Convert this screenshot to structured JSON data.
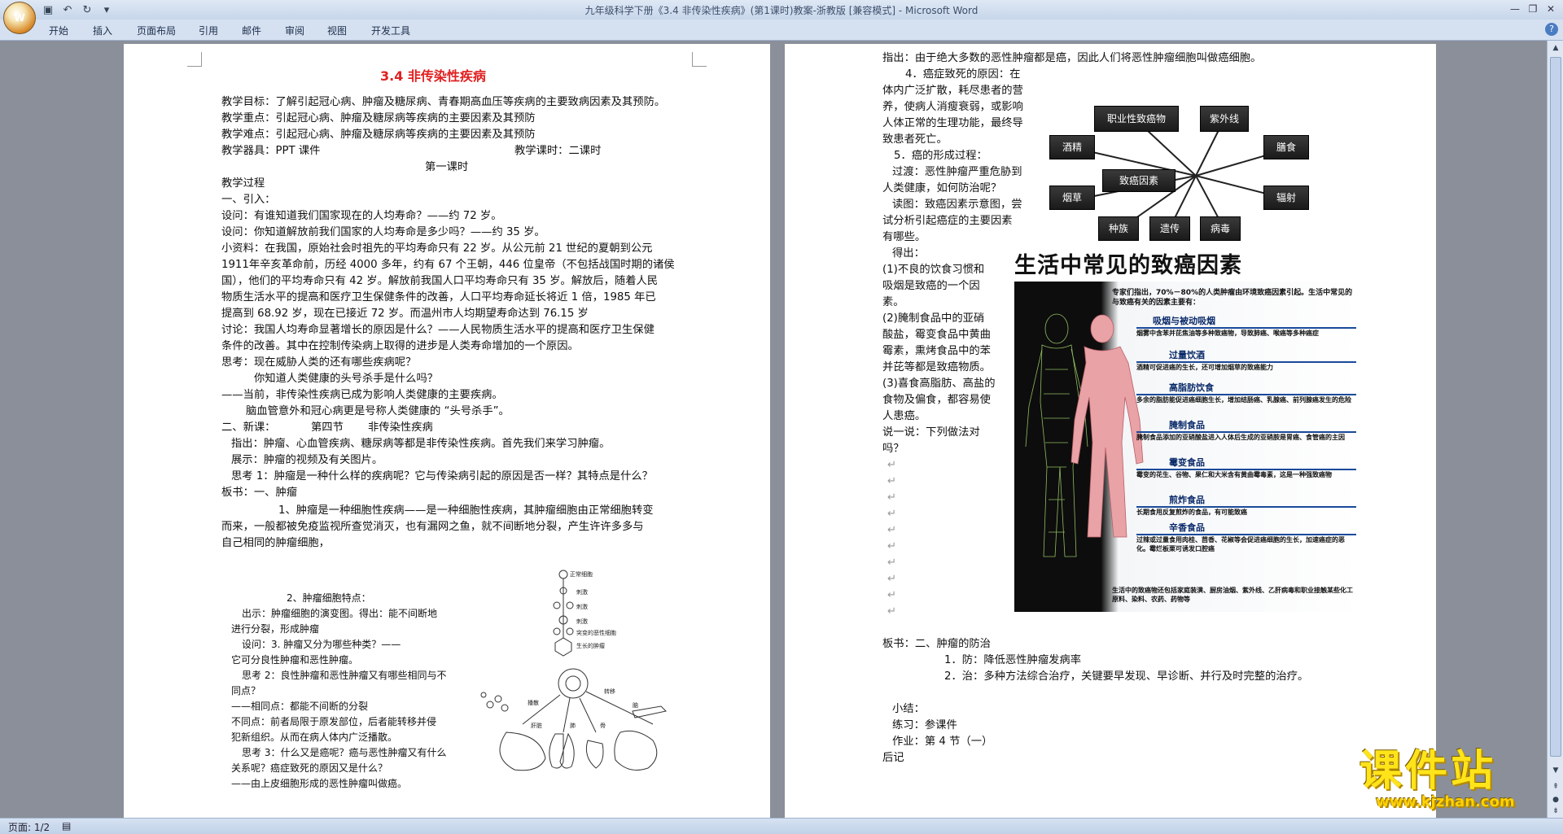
{
  "window": {
    "title": "九年级科学下册《3.4 非传染性疾病》(第1课时)教案-浙教版 [兼容模式] - Microsoft Word",
    "office_button": "W"
  },
  "ribbon": {
    "tabs": [
      "开始",
      "插入",
      "页面布局",
      "引用",
      "邮件",
      "审阅",
      "视图",
      "开发工具"
    ]
  },
  "status": {
    "page": "页面: 1/2"
  },
  "watermark": {
    "text": "课件站",
    "url": "www.kjzhan.com"
  },
  "left_page": {
    "title": "3.4 非传染性疾病",
    "lines": [
      "教学目标：了解引起冠心病、肿瘤及糖尿病、青春期高血压等疾病的主要致病因素及其预防。",
      "教学重点：引起冠心病、肿瘤及糖尿病等疾病的主要因素及其预防",
      "教学难点：引起冠心病、肿瘤及糖尿病等疾病的主要因素及其预防",
      "教学器具：PPT 课件",
      "教学课时：二课时",
      "第一课时",
      "教学过程",
      "一、引入：",
      "设问：有谁知道我们国家现在的人均寿命？——约 72 岁。",
      "设问：你知道解放前我们国家的人均寿命是多少吗？——约 35 岁。",
      "小资料：在我国，原始社会时祖先的平均寿命只有 22 岁。从公元前 21 世纪的夏朝到公元",
      "1911年辛亥革命前，历经 4000 多年，约有 67 个王朝，446 位皇帝（不包括战国时期的诸侯",
      "国），他们的平均寿命只有 42 岁。解放前我国人口平均寿命只有 35 岁。解放后，随着人民",
      "物质生活水平的提高和医疗卫生保健条件的改善，人口平均寿命延长将近 1 倍，1985 年已",
      "提高到 68.92 岁，现在已接近 72 岁。而温州市人均期望寿命达到 76.15 岁",
      "讨论：我国人均寿命显著增长的原因是什么？——人民物质生活水平的提高和医疗卫生保健",
      "条件的改善。其中在控制传染病上取得的进步是人类寿命增加的一个原因。",
      "思考：现在威胁人类的还有哪些疾病呢？",
      "你知道人类健康的头号杀手是什么吗？",
      "——当前，非传染性疾病已成为影响人类健康的主要疾病。",
      "脑血管意外和冠心病更是号称人类健康的 “头号杀手”。",
      "二、新课：",
      "第四节",
      "非传染性疾病",
      "指出：肿瘤、心血管疾病、糖尿病等都是非传染性疾病。首先我们来学习肿瘤。",
      "展示：肿瘤的视频及有关图片。",
      "思考 1：肿瘤是一种什么样的疾病呢？它与传染病引起的原因是否一样？其特点是什么？",
      "板书：一、肿瘤",
      "1、肿瘤是一种细胞性疾病——是一种细胞性疾病，其肿瘤细胞由正常细胞转变",
      "而来，一般都被免疫监视所查觉消灭，也有漏网之鱼，就不间断地分裂，产生许许多多与",
      "自己相同的肿瘤细胞，"
    ],
    "small_lines": [
      "2、肿瘤细胞特点：",
      "出示：肿瘤细胞的演变图。得出：能不间断地",
      "进行分裂，形成肿瘤",
      "设问：3. 肿瘤又分为哪些种类？——",
      "它可分良性肿瘤和恶性肿瘤。",
      "思考 2：良性肿瘤和恶性肿瘤又有哪些相同与不",
      "同点？",
      "——相同点：都能不间断的分裂",
      "不同点：前者局限于原发部位，后者能转移并侵",
      "犯新组织。从而在病人体内广泛播散。",
      "思考 3：什么又是癌呢？癌与恶性肿瘤又有什么",
      "关系呢？癌症致死的原因又是什么？",
      "——由上皮细胞形成的恶性肿瘤叫做癌。"
    ],
    "diagram_labels": [
      "正常细胞",
      "刺激",
      "刺激",
      "刺激",
      "突变的恶性细胞",
      "生长的肿瘤",
      "播散",
      "转移",
      "肝脏",
      "肺",
      "骨",
      "脑"
    ]
  },
  "right_page": {
    "lines": [
      "指出：由于绝大多数的恶性肿瘤都是癌，因此人们将恶性肿瘤细胞叫做癌细胞。",
      "4．癌症致死的原因：在",
      "体内广泛扩散，耗尽患者的营",
      "养，使病人消瘦衰弱，或影响",
      "人体正常的生理功能，最终导",
      "致患者死亡。",
      "5．癌的形成过程：",
      "过渡：恶性肿瘤严重危胁到",
      "人类健康，如何防治呢？",
      "读图：致癌因素示意图，尝",
      "试分析引起癌症的主要因素",
      "有哪些。",
      "得出：",
      "(1)不良的饮食习惯和",
      "吸烟是致癌的一个因",
      "素。",
      "(2)腌制食品中的亚硝",
      "酸盐，霉变食品中黄曲",
      "霉素，熏烤食品中的苯",
      "并芘等都是致癌物质。",
      "(3)喜食高脂肪、高盐的",
      "食物及偏食，都容易使",
      "人患癌。",
      "说一说：下列做法对",
      "吗？",
      "板书：二、肿瘤的防治",
      "1．防：降低恶性肿瘤发病率",
      "2．治：多种方法综合治疗，关键要早发现、早诊断、并行及时完整的治疗。",
      "小结：",
      "练习：参课件",
      "作业：第 4 节（一）",
      "后记"
    ],
    "diagram": {
      "center": "致癌因素",
      "nodes": [
        "职业性致癌物",
        "紫外线",
        "酒精",
        "膳食",
        "烟草",
        "辐射",
        "种族",
        "遗传",
        "病毒"
      ]
    },
    "poster": {
      "title": "生活中常见的致癌因素",
      "intro": "专家们指出，70%－80%的人类肿瘤由环境致癌因素引起。生活中常见的与致癌有关的因素主要有：",
      "items": [
        {
          "head": "吸烟与被动吸烟",
          "body": "烟雾中含苯并芘焦油等多种致癌物，导致肺癌、喉癌等多种癌症"
        },
        {
          "head": "过量饮酒",
          "body": "酒精可促进癌的生长，还可增加烟草的致癌能力"
        },
        {
          "head": "高脂肪饮食",
          "body": "多余的脂肪能促进癌细胞生长，增加结肠癌、乳腺癌、前列腺癌发生的危险"
        },
        {
          "head": "腌制食品",
          "body": "腌制食品添加的亚硝酸盐进入人体后生成的亚硝胺是胃癌、食管癌的主因"
        },
        {
          "head": "霉变食品",
          "body": "霉变的花生、谷物、果仁和大米含有黄曲霉毒素，这是一种强致癌物"
        },
        {
          "head": "煎炸食品",
          "body": "长期食用反复煎炸的食品，有可能致癌"
        },
        {
          "head": "辛香食品",
          "body": "过辣或过量食用肉桂、茴香、花椒等会促进癌细胞的生长，加速癌症的恶化。霉烂板栗可诱发口腔癌"
        }
      ],
      "footer": "生活中的致癌物还包括家庭装潢、厨房油烟、紫外线、乙肝病毒和职业接触某些化工原料、染料、农药、药物等"
    }
  }
}
